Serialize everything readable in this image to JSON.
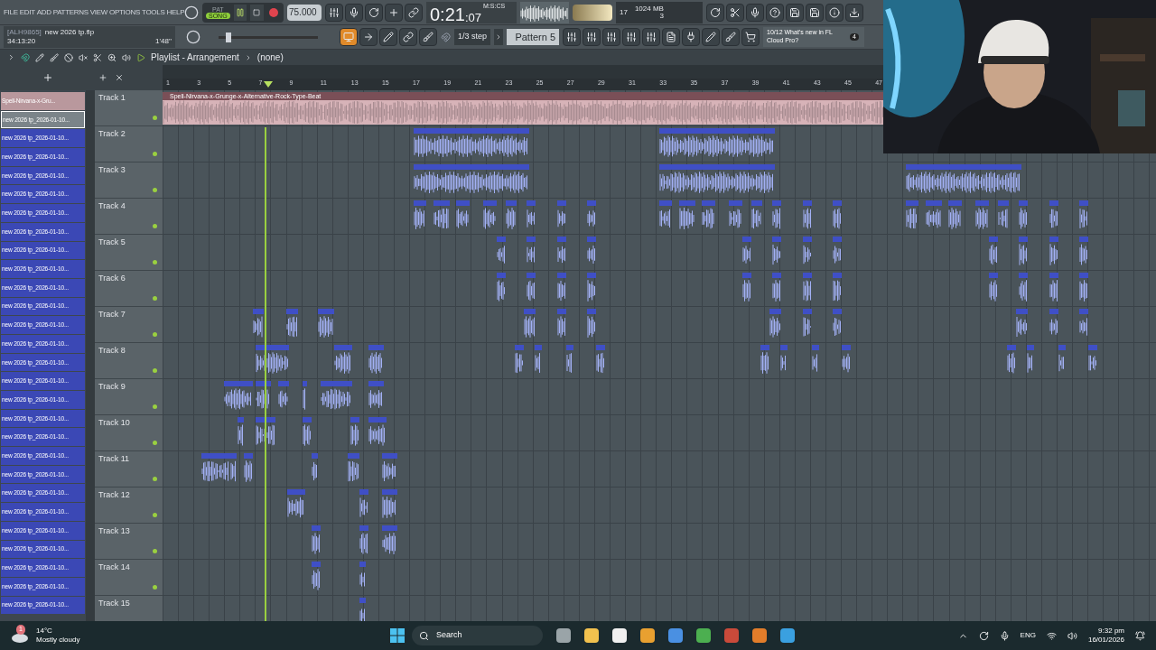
{
  "menu": [
    "FILE",
    "EDIT",
    "ADD",
    "PATTERNS",
    "VIEW",
    "OPTIONS",
    "TOOLS",
    "HELP"
  ],
  "transport": {
    "modes": [
      {
        "label": "PAT",
        "selected": false
      },
      {
        "label": "SONG",
        "selected": true
      }
    ],
    "playing": true,
    "tempo": "75.000",
    "time": "0:21",
    "time_cs": ":07",
    "time_format": "M:S:CS"
  },
  "project": {
    "id": "[ALH9865]",
    "file": "new 2026 tp.flp",
    "elapsed": "34:13:20",
    "length": "1'48''"
  },
  "master_pitch": {
    "level": 0.08
  },
  "snap": "1/3 step",
  "pattern": "Pattern 5",
  "monitor": {
    "cpu": "17",
    "memory": "1024 MB",
    "polyphony": "3"
  },
  "news": {
    "count": "10/12",
    "text": "What's new in FL Cloud Pro?",
    "badge": "4"
  },
  "playlist": {
    "title": "Playlist - Arrangement",
    "arrangement": "(none)",
    "ruler": [
      "1",
      "3",
      "5",
      "7",
      "9",
      "11",
      "13",
      "15",
      "17",
      "19",
      "21",
      "23",
      "25",
      "27",
      "29",
      "31",
      "33",
      "35",
      "37",
      "39",
      "41",
      "43",
      "45",
      "47"
    ],
    "clip_title": "Spell-Nirvana-x-Grunge-x-Alternative-Rock-Type-Beat",
    "tracks": [
      "Track 1",
      "Track 2",
      "Track 3",
      "Track 4",
      "Track 5",
      "Track 6",
      "Track 7",
      "Track 8",
      "Track 9",
      "Track 10",
      "Track 11",
      "Track 12",
      "Track 13",
      "Track 14",
      "Track 15"
    ]
  },
  "browser": [
    {
      "label": "Spell-Nirvana-x-Gru...",
      "kind": "audio",
      "selected": false
    },
    {
      "label": "new 2026 tp_2026-01-10...",
      "kind": "clip",
      "selected": true
    },
    {
      "label": "new 2026 tp_2026-01-10...",
      "kind": "clip",
      "selected": false
    },
    {
      "label": "new 2026 tp_2026-01-10...",
      "kind": "clip",
      "selected": false
    },
    {
      "label": "new 2026 tp_2026-01-10...",
      "kind": "clip",
      "selected": false
    },
    {
      "label": "new 2026 tp_2026-01-10...",
      "kind": "clip",
      "selected": false
    },
    {
      "label": "new 2026 tp_2026-01-10...",
      "kind": "clip",
      "selected": false
    },
    {
      "label": "new 2026 tp_2026-01-10...",
      "kind": "clip",
      "selected": false
    },
    {
      "label": "new 2026 tp_2026-01-10...",
      "kind": "clip",
      "selected": false
    },
    {
      "label": "new 2026 tp_2026-01-10...",
      "kind": "clip",
      "selected": false
    },
    {
      "label": "new 2026 tp_2026-01-10...",
      "kind": "clip",
      "selected": false
    },
    {
      "label": "new 2026 tp_2026-01-10...",
      "kind": "clip",
      "selected": false
    },
    {
      "label": "new 2026 tp_2026-01-10...",
      "kind": "clip",
      "selected": false
    },
    {
      "label": "new 2026 tp_2026-01-10...",
      "kind": "clip",
      "selected": false
    },
    {
      "label": "new 2026 tp_2026-01-10...",
      "kind": "clip",
      "selected": false
    },
    {
      "label": "new 2026 tp_2026-01-10...",
      "kind": "clip",
      "selected": false
    },
    {
      "label": "new 2026 tp_2026-01-10...",
      "kind": "clip",
      "selected": false
    },
    {
      "label": "new 2026 tp_2026-01-10...",
      "kind": "clip",
      "selected": false
    },
    {
      "label": "new 2026 tp_2026-01-10...",
      "kind": "clip",
      "selected": false
    },
    {
      "label": "new 2026 tp_2026-01-10...",
      "kind": "clip",
      "selected": false
    },
    {
      "label": "new 2026 tp_2026-01-10...",
      "kind": "clip",
      "selected": false
    },
    {
      "label": "new 2026 tp_2026-01-10...",
      "kind": "clip",
      "selected": false
    },
    {
      "label": "new 2026 tp_2026-01-10...",
      "kind": "clip",
      "selected": false
    },
    {
      "label": "new 2026 tp_2026-01-10...",
      "kind": "clip",
      "selected": false
    },
    {
      "label": "new 2026 tp_2026-01-10...",
      "kind": "clip",
      "selected": false
    },
    {
      "label": "new 2026 tp_2026-01-10...",
      "kind": "clip",
      "selected": false
    },
    {
      "label": "new 2026 tp_2026-01-10...",
      "kind": "clip",
      "selected": false
    },
    {
      "label": "new 2026 tp_2026-01-10...",
      "kind": "clip",
      "selected": false
    }
  ],
  "taskbar": {
    "weather_badge": "1",
    "temperature": "14°C",
    "weather": "Mostly cloudy",
    "search": "Search",
    "language": "ENG",
    "time": "9:32 pm",
    "date": "16/01/2026"
  }
}
